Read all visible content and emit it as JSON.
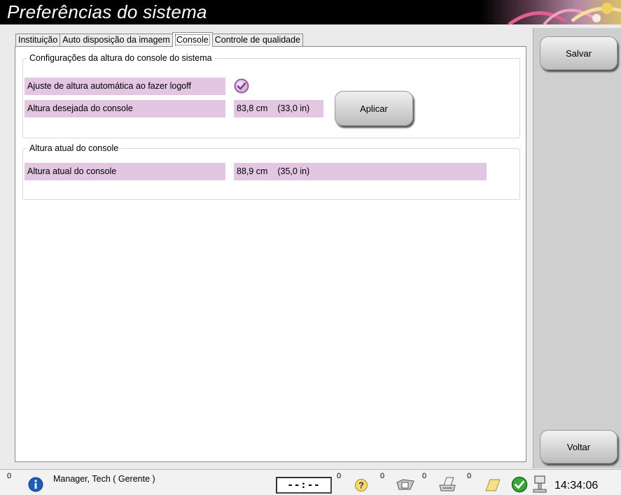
{
  "window": {
    "title": "Preferências do sistema"
  },
  "tabs": [
    {
      "label": "Instituição",
      "active": false
    },
    {
      "label": "Auto disposição da imagem",
      "active": false
    },
    {
      "label": "Console",
      "active": true
    },
    {
      "label": "Controle de qualidade",
      "active": false
    }
  ],
  "console_height_settings": {
    "legend": "Configurações da altura do console do sistema",
    "auto_adjust": {
      "label": "Ajuste de altura automática ao fazer logoff",
      "checked": true
    },
    "desired_height": {
      "label": "Altura desejada do console",
      "value": "83,8 cm    (33,0 in)"
    },
    "apply_label": "Aplicar"
  },
  "current_height": {
    "legend": "Altura atual do console",
    "label": "Altura atual do console",
    "value": "88,9 cm    (35,0 in)"
  },
  "side": {
    "save_label": "Salvar",
    "back_label": "Voltar"
  },
  "status": {
    "left_count": "0",
    "user": "Manager, Tech ( Gerente )",
    "timer": "--:--",
    "counts": [
      "0",
      "0",
      "0",
      "0"
    ],
    "time": "14:34:06"
  },
  "colors": {
    "field_bg": "#e2c6e2",
    "check": "#9b5aa8"
  },
  "icons": [
    "info-icon",
    "help-icon",
    "film-icon",
    "printer-icon",
    "notes-icon",
    "ok-check-icon",
    "console-icon"
  ]
}
